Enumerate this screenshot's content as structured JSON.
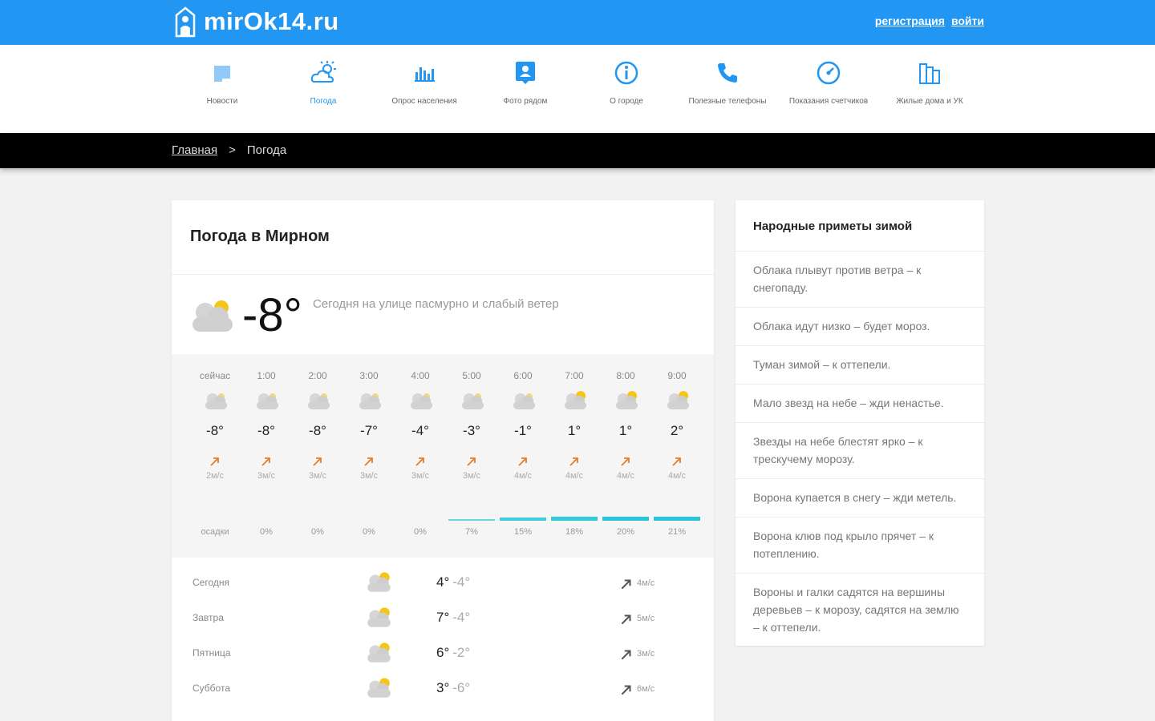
{
  "header": {
    "logo_text": "mirOk14.ru",
    "register_label": "регистрация",
    "login_label": "войти",
    "brand_color": "#2196f3"
  },
  "nav": {
    "items": [
      {
        "label": "Новости",
        "icon": "news-icon"
      },
      {
        "label": "Погода",
        "icon": "weather-icon",
        "active": true
      },
      {
        "label": "Опрос населения",
        "icon": "poll-chart-icon"
      },
      {
        "label": "Фото рядом",
        "icon": "photo-icon"
      },
      {
        "label": "О городе",
        "icon": "info-icon"
      },
      {
        "label": "Полезные телефоны",
        "icon": "phone-icon"
      },
      {
        "label": "Показания счетчиков",
        "icon": "meter-icon"
      },
      {
        "label": "Жилые дома и УК",
        "icon": "buildings-icon"
      }
    ]
  },
  "breadcrumb": {
    "home": "Главная",
    "separator": ">",
    "current": "Погода"
  },
  "weather": {
    "title": "Погода в Мирном",
    "current_temp": "-8°",
    "current_desc": "Сегодня на улице пасмурно и слабый ветер",
    "hourly": [
      {
        "time": "сейчас",
        "temp": "-8°",
        "wind": "2м/с",
        "precip": "",
        "precip_value": 0,
        "icon": "cloud-icon"
      },
      {
        "time": "1:00",
        "temp": "-8°",
        "wind": "3м/с",
        "precip": "0%",
        "precip_value": 0,
        "icon": "cloud-icon"
      },
      {
        "time": "2:00",
        "temp": "-8°",
        "wind": "3м/с",
        "precip": "0%",
        "precip_value": 0,
        "icon": "cloud-icon"
      },
      {
        "time": "3:00",
        "temp": "-7°",
        "wind": "3м/с",
        "precip": "0%",
        "precip_value": 0,
        "icon": "cloud-icon"
      },
      {
        "time": "4:00",
        "temp": "-4°",
        "wind": "3м/с",
        "precip": "0%",
        "precip_value": 0,
        "icon": "cloud-icon"
      },
      {
        "time": "5:00",
        "temp": "-3°",
        "wind": "3м/с",
        "precip": "7%",
        "precip_value": 7,
        "icon": "cloud-icon"
      },
      {
        "time": "6:00",
        "temp": "-1°",
        "wind": "4м/с",
        "precip": "15%",
        "precip_value": 15,
        "icon": "cloud-icon"
      },
      {
        "time": "7:00",
        "temp": "1°",
        "wind": "4м/с",
        "precip": "18%",
        "precip_value": 18,
        "icon": "partly-cloudy-icon"
      },
      {
        "time": "8:00",
        "temp": "1°",
        "wind": "4м/с",
        "precip": "20%",
        "precip_value": 20,
        "icon": "partly-cloudy-icon"
      },
      {
        "time": "9:00",
        "temp": "2°",
        "wind": "4м/с",
        "precip": "21%",
        "precip_value": 21,
        "icon": "partly-cloudy-icon"
      }
    ],
    "precip_label": "осадки",
    "daily": [
      {
        "day": "Сегодня",
        "hi": "4°",
        "lo": "-4°",
        "wind": "4м/с",
        "icon": "partly-cloudy-icon"
      },
      {
        "day": "Завтра",
        "hi": "7°",
        "lo": "-4°",
        "wind": "5м/с",
        "icon": "partly-cloudy-icon"
      },
      {
        "day": "Пятница",
        "hi": "6°",
        "lo": "-2°",
        "wind": "3м/с",
        "icon": "partly-cloudy-icon"
      },
      {
        "day": "Суббота",
        "hi": "3°",
        "lo": "-6°",
        "wind": "6м/с",
        "icon": "partly-cloudy-icon"
      }
    ],
    "precip_color": "#26c6da",
    "wind_arrow_color": "#e67e22"
  },
  "signs": {
    "title": "Народные приметы зимой",
    "items": [
      "Облака плывут против ветра – к снегопаду.",
      "Облака идут низко – будет мороз.",
      "Туман зимой – к оттепели.",
      "Мало звезд на небе – жди ненастье.",
      "Звезды на небе блестят ярко – к трескучему морозу.",
      "Ворона купается в снегу – жди метель.",
      "Ворона клюв под крыло прячет – к потеплению.",
      "Вороны и галки садятся на вершины деревьев – к морозу, садятся на землю – к оттепели."
    ]
  }
}
